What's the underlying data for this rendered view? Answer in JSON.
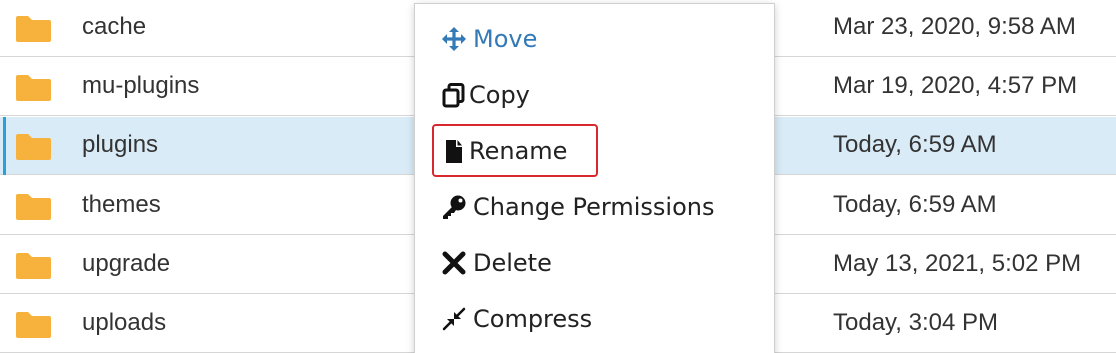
{
  "file_list": {
    "rows": [
      {
        "name": "cache",
        "modified": "Mar 23, 2020, 9:58 AM",
        "selected": false
      },
      {
        "name": "mu-plugins",
        "modified": "Mar 19, 2020, 4:57 PM",
        "selected": false
      },
      {
        "name": "plugins",
        "modified": "Today, 6:59 AM",
        "selected": true
      },
      {
        "name": "themes",
        "modified": "Today, 6:59 AM",
        "selected": false
      },
      {
        "name": "upgrade",
        "modified": "May 13, 2021, 5:02 PM",
        "selected": false
      },
      {
        "name": "uploads",
        "modified": "Today, 3:04 PM",
        "selected": false
      }
    ],
    "row_icon": "folder-icon"
  },
  "context_menu": {
    "items": [
      {
        "label": "Move",
        "icon": "move-arrows-icon"
      },
      {
        "label": "Copy",
        "icon": "copy-icon"
      },
      {
        "label": "Rename",
        "icon": "file-icon"
      },
      {
        "label": "Change Permissions",
        "icon": "key-icon"
      },
      {
        "label": "Delete",
        "icon": "x-mark-icon"
      },
      {
        "label": "Compress",
        "icon": "compress-icon"
      }
    ],
    "highlighted_item": "Rename"
  },
  "colors": {
    "folder": "#f6b23c",
    "selected_row": "#d9ebf7",
    "selected_accent": "#2a9fd8",
    "move_link": "#337ab7",
    "highlight_box": "#d9272e"
  }
}
